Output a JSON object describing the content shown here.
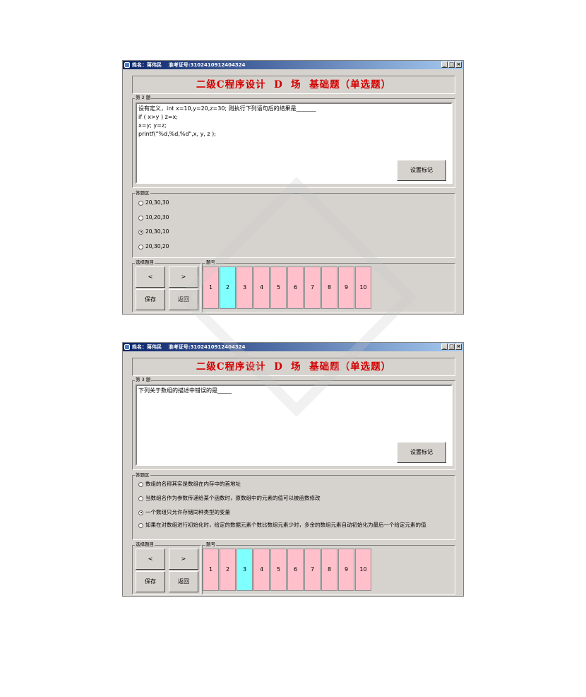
{
  "windows": [
    {
      "title_name": "姓名：蒋伟民",
      "title_id": "准考证号:3102410912404324",
      "title_buttons": [
        "_",
        "□",
        "×"
      ],
      "banner": "二级C程序设计  D  场  基础题（单选题）",
      "question_label": "第 2 题",
      "question_lines": [
        "设有定义，int x=10,y=20,z=30; 则执行下列语句后的结果是_______",
        "if ( x>y ) z=x;",
        "x=y; y=z;",
        "printf(\"%d,%d,%d\",x, y, z );"
      ],
      "mark_button": "设置标记",
      "answer_label": "答题区",
      "options": [
        "20,30,30",
        "10,20,30",
        "20,30,10",
        "20,30,20"
      ],
      "selected_option": 2,
      "select_label": "选择题目",
      "prev_label": "<",
      "next_label": ">",
      "save_label": "保存",
      "return_label": "返回",
      "qnum_label": "题号",
      "question_numbers": [
        "1",
        "2",
        "3",
        "4",
        "5",
        "6",
        "7",
        "8",
        "9",
        "10"
      ],
      "current_question": 2
    },
    {
      "title_name": "姓名：蒋伟民",
      "title_id": "准考证号:3102410912404324",
      "title_buttons": [
        "_",
        "□",
        "×"
      ],
      "banner": "二级C程序设计  D  场  基础题（单选题）",
      "question_label": "第 3 题",
      "question_lines": [
        "下列关于数组的描述中错误的是_____"
      ],
      "mark_button": "设置标记",
      "answer_label": "答题区",
      "options": [
        "数组的名称其实是数组在内存中的首地址",
        "当数组名作为参数传递给某个函数时，原数组中的元素的值可以被函数修改",
        "一个数组只允许存储同种类型的变量",
        "如果在对数组进行初始化时，给定的数据元素个数比数组元素少时，多余的数组元素自动初始化为最后一个给定元素的值"
      ],
      "selected_option": 2,
      "select_label": "选择题目",
      "prev_label": "<",
      "next_label": ">",
      "save_label": "保存",
      "return_label": "返回",
      "qnum_label": "题号",
      "question_numbers": [
        "1",
        "2",
        "3",
        "4",
        "5",
        "6",
        "7",
        "8",
        "9",
        "10"
      ],
      "current_question": 3
    }
  ],
  "colors": {
    "title_gradient_start": "#0a246a",
    "title_gradient_end": "#a6caf0",
    "banner_text": "#d40000",
    "window_bg": "#d6d3ce",
    "question_number_bg": "#ffc0cb",
    "current_question_bg": "#80ffff"
  }
}
